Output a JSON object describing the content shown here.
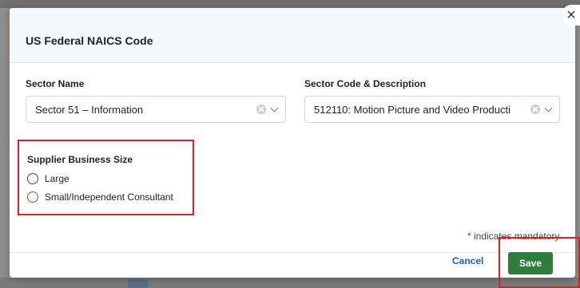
{
  "modal": {
    "title": "US Federal NAICS Code",
    "close_icon": "close-icon"
  },
  "sector_name": {
    "label": "Sector Name",
    "value": "Sector 51 – Information"
  },
  "sector_code": {
    "label": "Sector Code & Description",
    "value": "512110: Motion Picture and Video Producti"
  },
  "business_size": {
    "title": "Supplier Business Size",
    "options": [
      {
        "label": "Large",
        "selected": false
      },
      {
        "label": "Small/Independent Consultant",
        "selected": false
      }
    ]
  },
  "mandatory_note": {
    "star": "*",
    "text": " indicates mandatory"
  },
  "footer": {
    "cancel_label": "Cancel",
    "save_label": "Save"
  },
  "colors": {
    "accent_green": "#2e7d3f",
    "highlight_red": "#e01e26",
    "link_blue": "#1f5fbf",
    "header_bg": "#f3f8fd"
  }
}
